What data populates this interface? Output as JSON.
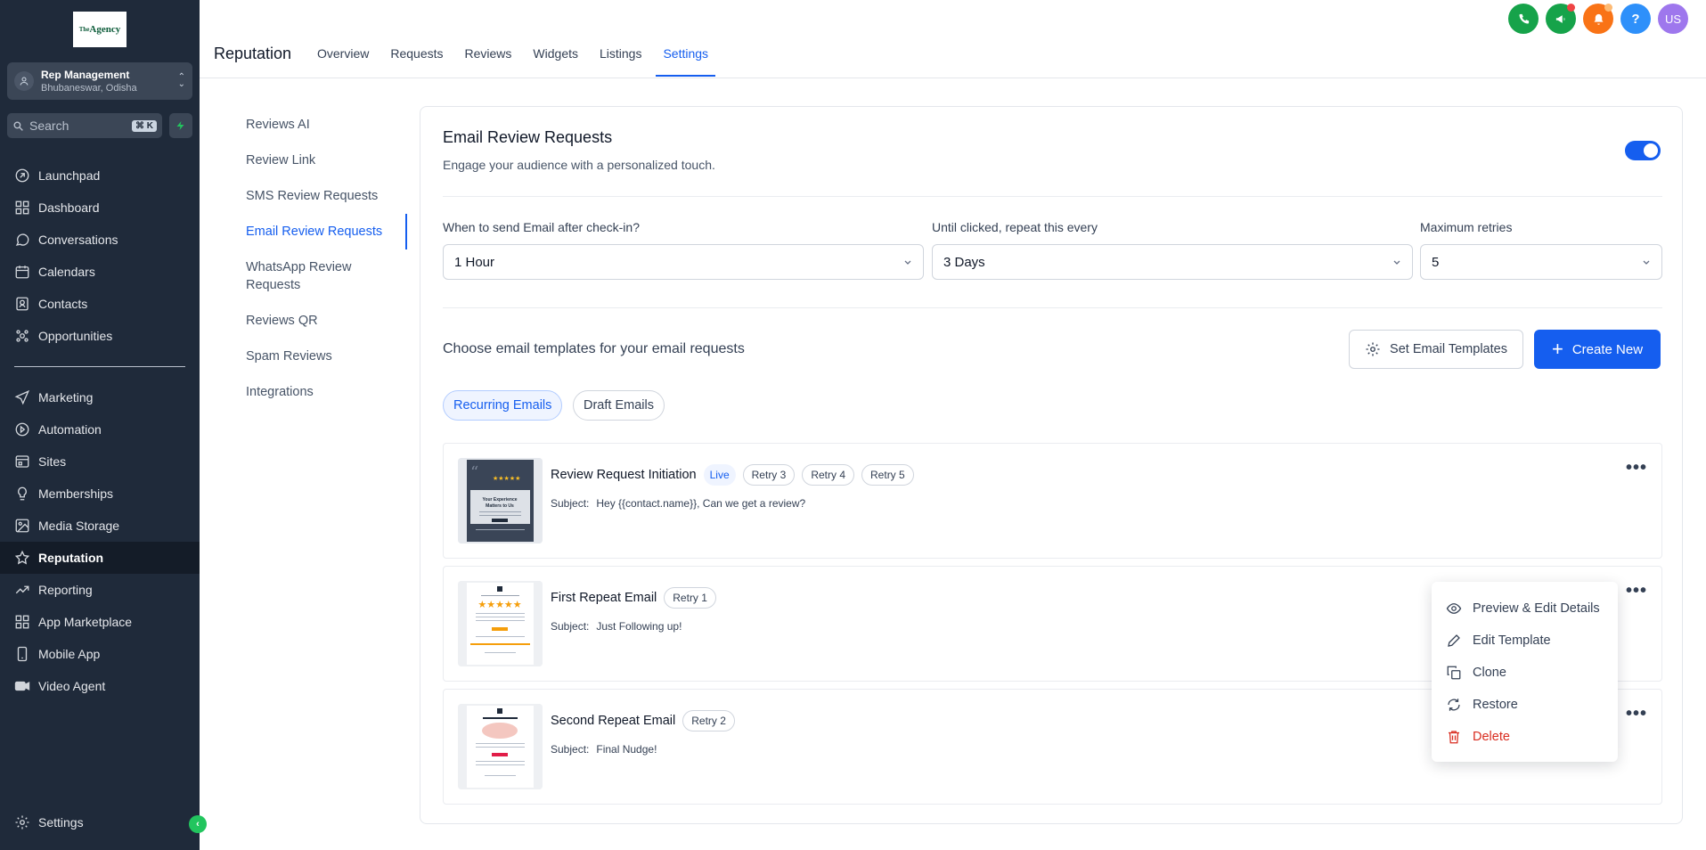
{
  "sidebar": {
    "logo_text": "Agency",
    "location": {
      "name": "Rep Management",
      "address": "Bhubaneswar, Odisha"
    },
    "search": {
      "placeholder": "Search",
      "shortcut": "⌘ K"
    },
    "items": [
      {
        "label": "Launchpad",
        "icon": "rocket-icon"
      },
      {
        "label": "Dashboard",
        "icon": "grid-icon"
      },
      {
        "label": "Conversations",
        "icon": "chat-icon"
      },
      {
        "label": "Calendars",
        "icon": "calendar-icon"
      },
      {
        "label": "Contacts",
        "icon": "contacts-icon"
      },
      {
        "label": "Opportunities",
        "icon": "opportunities-icon"
      }
    ],
    "items2": [
      {
        "label": "Marketing",
        "icon": "send-icon"
      },
      {
        "label": "Automation",
        "icon": "automation-icon"
      },
      {
        "label": "Sites",
        "icon": "sites-icon"
      },
      {
        "label": "Memberships",
        "icon": "memberships-icon"
      },
      {
        "label": "Media Storage",
        "icon": "image-icon"
      },
      {
        "label": "Reputation",
        "icon": "star-icon",
        "active": true
      },
      {
        "label": "Reporting",
        "icon": "trend-icon"
      },
      {
        "label": "App Marketplace",
        "icon": "apps-icon"
      },
      {
        "label": "Mobile App",
        "icon": "mobile-icon"
      },
      {
        "label": "Video Agent",
        "icon": "video-icon"
      }
    ],
    "settings_label": "Settings"
  },
  "header": {
    "title": "Reputation",
    "tabs": [
      "Overview",
      "Requests",
      "Reviews",
      "Widgets",
      "Listings",
      "Settings"
    ],
    "active_tab": "Settings",
    "avatar_initials": "US"
  },
  "submenu": [
    "Reviews AI",
    "Review Link",
    "SMS Review Requests",
    "Email Review Requests",
    "WhatsApp Review Requests",
    "Reviews QR",
    "Spam Reviews",
    "Integrations"
  ],
  "submenu_active": "Email Review Requests",
  "card": {
    "title": "Email Review Requests",
    "subtitle": "Engage your audience with a personalized touch.",
    "toggle_on": true,
    "fields": [
      {
        "label": "When to send Email after check-in?",
        "value": "1 Hour"
      },
      {
        "label": "Until clicked, repeat this every",
        "value": "3 Days"
      },
      {
        "label": "Maximum retries",
        "value": "5"
      }
    ],
    "templates_heading": "Choose email templates for your email requests",
    "set_templates_label": "Set Email Templates",
    "create_new_label": "Create New",
    "pills": [
      "Recurring Emails",
      "Draft Emails"
    ],
    "subject_label": "Subject:",
    "templates": [
      {
        "name": "Review Request Initiation",
        "badges": [
          "Live",
          "Retry 3",
          "Retry 4",
          "Retry 5"
        ],
        "subject": "Hey {{contact.name}}, Can we get a review?"
      },
      {
        "name": "First Repeat Email",
        "badges": [
          "Retry 1"
        ],
        "subject": "Just Following up!"
      },
      {
        "name": "Second Repeat Email",
        "badges": [
          "Retry 2"
        ],
        "subject": "Final Nudge!"
      }
    ]
  },
  "context_menu": [
    {
      "label": "Preview & Edit Details",
      "icon": "eye-icon"
    },
    {
      "label": "Edit Template",
      "icon": "pencil-icon"
    },
    {
      "label": "Clone",
      "icon": "clone-icon"
    },
    {
      "label": "Restore",
      "icon": "restore-icon"
    },
    {
      "label": "Delete",
      "icon": "trash-icon"
    }
  ],
  "colors": {
    "sidebar": "#1f2a3a",
    "accent": "#155eef",
    "danger": "#d92d20"
  }
}
